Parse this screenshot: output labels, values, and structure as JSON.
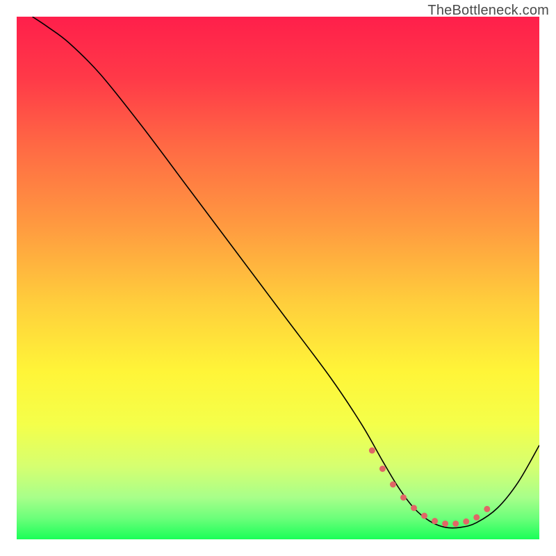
{
  "watermark": "TheBottleneck.com",
  "chart_data": {
    "type": "line",
    "title": "",
    "xlabel": "",
    "ylabel": "",
    "xlim": [
      0,
      100
    ],
    "ylim": [
      0,
      100
    ],
    "gradient_stops": [
      {
        "offset": 0.0,
        "color": "#ff1f4b"
      },
      {
        "offset": 0.12,
        "color": "#ff3a48"
      },
      {
        "offset": 0.25,
        "color": "#ff6a44"
      },
      {
        "offset": 0.4,
        "color": "#ff9a40"
      },
      {
        "offset": 0.55,
        "color": "#ffcf3c"
      },
      {
        "offset": 0.68,
        "color": "#fff538"
      },
      {
        "offset": 0.78,
        "color": "#f4ff4a"
      },
      {
        "offset": 0.86,
        "color": "#d6ff70"
      },
      {
        "offset": 0.92,
        "color": "#a8ff8a"
      },
      {
        "offset": 0.96,
        "color": "#6bff7a"
      },
      {
        "offset": 1.0,
        "color": "#1aff58"
      }
    ],
    "series": [
      {
        "name": "bottleneck-curve",
        "color": "#000000",
        "width": 1.6,
        "x": [
          3,
          6,
          10,
          16,
          24,
          33,
          42,
          51,
          60,
          66,
          70,
          73,
          76,
          79,
          82,
          85,
          88,
          92,
          96,
          100
        ],
        "y": [
          100,
          98,
          95,
          89,
          79,
          67,
          55,
          43,
          31,
          22,
          15,
          10,
          6,
          3.5,
          2.3,
          2.3,
          3.2,
          6,
          11,
          18
        ]
      }
    ],
    "marker_series": {
      "name": "optimal-zone-markers",
      "color": "#e06666",
      "radius": 4.5,
      "x": [
        68,
        70,
        72,
        74,
        76,
        78,
        80,
        82,
        84,
        86,
        88,
        90
      ],
      "y": [
        17,
        13.5,
        10.5,
        8,
        6,
        4.5,
        3.5,
        3,
        3,
        3.4,
        4.2,
        5.8
      ]
    }
  }
}
